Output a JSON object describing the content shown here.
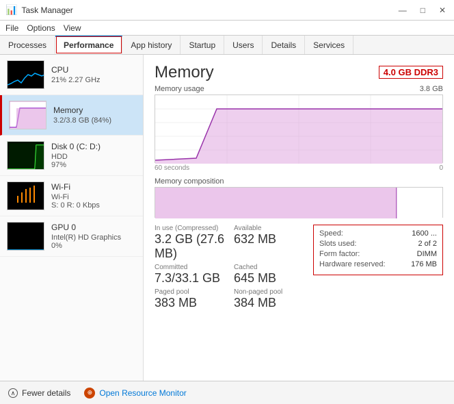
{
  "titlebar": {
    "icon": "📊",
    "title": "Task Manager",
    "minimize": "—",
    "maximize": "□",
    "close": "✕"
  },
  "menubar": {
    "items": [
      "File",
      "Options",
      "View"
    ]
  },
  "tabs": [
    {
      "label": "Processes",
      "active": false
    },
    {
      "label": "Performance",
      "active": true
    },
    {
      "label": "App history",
      "active": false
    },
    {
      "label": "Startup",
      "active": false
    },
    {
      "label": "Users",
      "active": false
    },
    {
      "label": "Details",
      "active": false
    },
    {
      "label": "Services",
      "active": false
    }
  ],
  "sidebar": {
    "items": [
      {
        "name": "CPU",
        "line1": "21% 2.27 GHz",
        "type": "cpu",
        "selected": false
      },
      {
        "name": "Memory",
        "line1": "3.2/3.8 GB (84%)",
        "type": "memory",
        "selected": true
      },
      {
        "name": "Disk 0 (C: D:)",
        "line1": "HDD",
        "line2": "97%",
        "type": "disk",
        "selected": false
      },
      {
        "name": "Wi-Fi",
        "line1": "Wi-Fi",
        "line2": "S: 0 R: 0 Kbps",
        "type": "wifi",
        "selected": false
      },
      {
        "name": "GPU 0",
        "line1": "Intel(R) HD Graphics",
        "line2": "0%",
        "type": "gpu",
        "selected": false
      }
    ]
  },
  "content": {
    "title": "Memory",
    "badge": "4.0 GB DDR3",
    "usage_chart_label": "Memory usage",
    "usage_chart_max": "3.8 GB",
    "time_left": "60 seconds",
    "time_right": "0",
    "composition_label": "Memory composition",
    "stats": [
      {
        "label": "In use (Compressed)",
        "value": "3.2 GB (27.6 MB)"
      },
      {
        "label": "Available",
        "value": "632 MB"
      },
      {
        "label": "Committed",
        "value": "7.3/33.1 GB"
      },
      {
        "label": "Cached",
        "value": "645 MB"
      },
      {
        "label": "Paged pool",
        "value": "383 MB"
      },
      {
        "label": "Non-paged pool",
        "value": "384 MB"
      }
    ],
    "specs": [
      {
        "label": "Speed:",
        "value": "1600 ..."
      },
      {
        "label": "Slots used:",
        "value": "2 of 2"
      },
      {
        "label": "Form factor:",
        "value": "DIMM"
      },
      {
        "label": "Hardware reserved:",
        "value": "176 MB"
      }
    ]
  },
  "footer": {
    "fewer_details": "Fewer details",
    "open_resource_monitor": "Open Resource Monitor"
  }
}
